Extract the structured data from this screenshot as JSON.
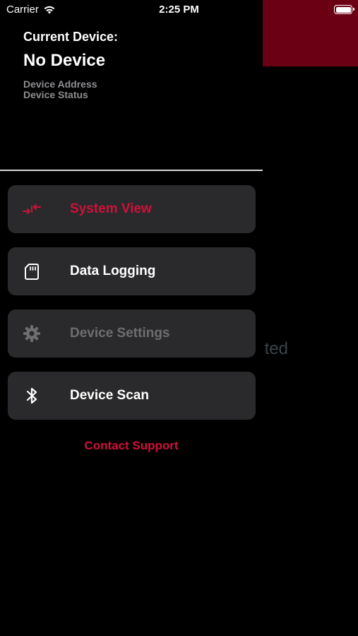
{
  "status_bar": {
    "carrier": "Carrier",
    "time": "2:25 PM",
    "wifi_icon": "wifi-icon",
    "battery_icon": "battery-icon"
  },
  "device": {
    "heading": "Current Device:",
    "name": "No Device",
    "address_label": "Device Address",
    "status_label": "Device Status"
  },
  "menu": [
    {
      "label": "System View",
      "icon": "system-view-icon",
      "state": "active"
    },
    {
      "label": "Data Logging",
      "icon": "sd-card-icon",
      "state": "normal"
    },
    {
      "label": "Device Settings",
      "icon": "gear-icon",
      "state": "disabled"
    },
    {
      "label": "Device Scan",
      "icon": "bluetooth-icon",
      "state": "normal"
    }
  ],
  "contact_support": "Contact Support",
  "background": {
    "partial_text": "ted"
  },
  "colors": {
    "accent": "#d0103a",
    "background": "#000000",
    "card": "#2a2a2c",
    "disabled": "#6e6e72",
    "header_accent": "#6b0014"
  }
}
